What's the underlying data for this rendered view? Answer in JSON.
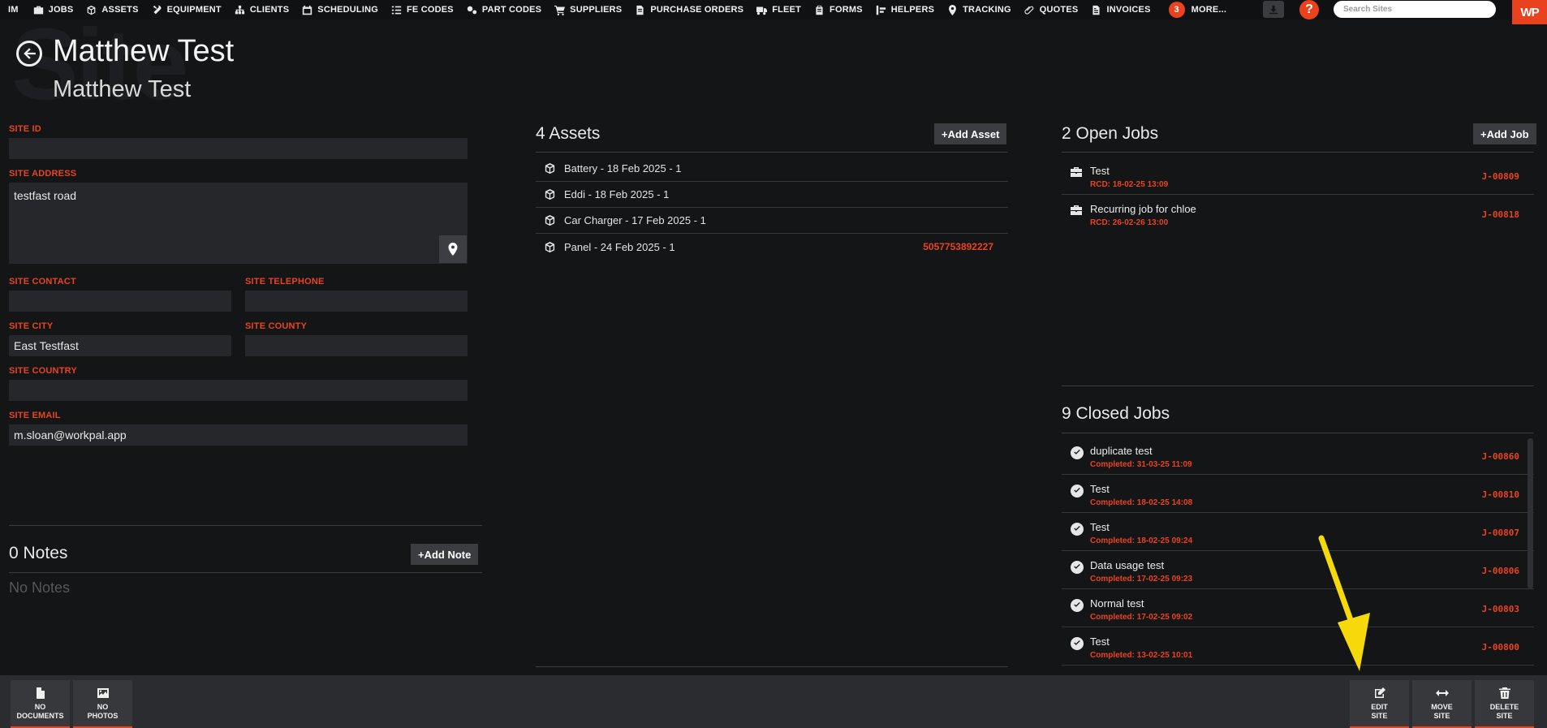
{
  "nav": {
    "first": "IM",
    "items": [
      {
        "label": "JOBS",
        "icon": "briefcase-icon"
      },
      {
        "label": "ASSETS",
        "icon": "cube-icon"
      },
      {
        "label": "EQUIPMENT",
        "icon": "tools-icon"
      },
      {
        "label": "CLIENTS",
        "icon": "sitemap-icon"
      },
      {
        "label": "SCHEDULING",
        "icon": "calendar-icon"
      },
      {
        "label": "FE CODES",
        "icon": "list-icon"
      },
      {
        "label": "PART CODES",
        "icon": "cogs-icon"
      },
      {
        "label": "SUPPLIERS",
        "icon": "cart-icon"
      },
      {
        "label": "PURCHASE ORDERS",
        "icon": "file-icon"
      },
      {
        "label": "FLEET",
        "icon": "truck-icon"
      },
      {
        "label": "FORMS",
        "icon": "clipboard-icon"
      },
      {
        "label": "HELPERS",
        "icon": "helpers-icon"
      },
      {
        "label": "TRACKING",
        "icon": "map-marker-icon"
      },
      {
        "label": "QUOTES",
        "icon": "paperclip-icon"
      },
      {
        "label": "INVOICES",
        "icon": "invoice-icon"
      }
    ],
    "more_count": "3",
    "more_label": "MORE...",
    "help_label": "?",
    "search_placeholder": "Search Sites",
    "logo_text": "WP"
  },
  "header": {
    "watermark": "Site",
    "title": "Matthew Test",
    "subtitle": "Matthew Test"
  },
  "form": {
    "site_id_label": "SITE ID",
    "site_id_value": "",
    "site_address_label": "SITE ADDRESS",
    "site_address_value": "testfast road",
    "site_contact_label": "SITE CONTACT",
    "site_contact_value": "",
    "site_telephone_label": "SITE TELEPHONE",
    "site_telephone_value": "",
    "site_city_label": "SITE CITY",
    "site_city_value": "East Testfast",
    "site_county_label": "SITE COUNTY",
    "site_county_value": "",
    "site_country_label": "SITE COUNTRY",
    "site_country_value": "",
    "site_email_label": "SITE EMAIL",
    "site_email_value": "m.sloan@workpal.app"
  },
  "notes": {
    "title": "0 Notes",
    "add_label": "+Add Note",
    "empty_text": "No Notes"
  },
  "assets": {
    "title": "4 Assets",
    "add_label": "+Add Asset",
    "items": [
      {
        "name": "Battery - 18 Feb 2025 - 1",
        "code": ""
      },
      {
        "name": "Eddi - 18 Feb 2025 - 1",
        "code": ""
      },
      {
        "name": "Car Charger - 17 Feb 2025 - 1",
        "code": ""
      },
      {
        "name": "Panel - 24 Feb 2025 - 1",
        "code": "5057753892227"
      }
    ]
  },
  "open_jobs": {
    "title": "2 Open Jobs",
    "add_label": "+Add Job",
    "items": [
      {
        "name": "Test",
        "sub": "RCD: 18-02-25 13:09",
        "ref": "J-00809"
      },
      {
        "name": "Recurring job for chloe",
        "sub": "RCD: 26-02-26 13:00",
        "ref": "J-00818"
      }
    ]
  },
  "closed_jobs": {
    "title": "9 Closed Jobs",
    "items": [
      {
        "name": "duplicate test",
        "sub": "Completed: 31-03-25 11:09",
        "ref": "J-00860"
      },
      {
        "name": "Test",
        "sub": "Completed: 18-02-25 14:08",
        "ref": "J-00810"
      },
      {
        "name": "Test",
        "sub": "Completed: 18-02-25 09:24",
        "ref": "J-00807"
      },
      {
        "name": "Data usage test",
        "sub": "Completed: 17-02-25 09:23",
        "ref": "J-00806"
      },
      {
        "name": "Normal test",
        "sub": "Completed: 17-02-25 09:02",
        "ref": "J-00803"
      },
      {
        "name": "Test",
        "sub": "Completed: 13-02-25 10:01",
        "ref": "J-00800"
      }
    ]
  },
  "footer": {
    "documents_label": "NO\nDOCUMENTS",
    "photos_label": "NO\nPHOTOS",
    "edit_label": "EDIT\nSITE",
    "move_label": "MOVE\nSITE",
    "delete_label": "DELETE\nSITE"
  },
  "colors": {
    "accent": "#e8431e",
    "background": "#141517",
    "field": "#25272a",
    "annotation": "#f5d90a"
  }
}
